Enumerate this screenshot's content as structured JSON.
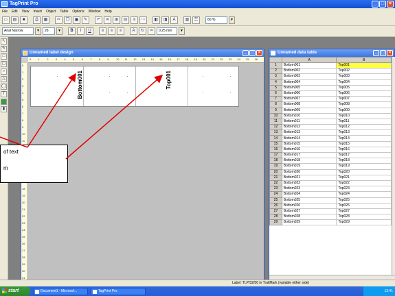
{
  "app": {
    "title": "TagPrint Pro"
  },
  "menu": [
    "File",
    "Edit",
    "View",
    "Insert",
    "Object",
    "Table",
    "Options",
    "Window",
    "Help"
  ],
  "toolbar": {
    "zoom": "60 %"
  },
  "format_bar": {
    "font": "Arial Narrow",
    "size": "26",
    "bold": "B",
    "italic": "I",
    "underline": "U",
    "dimension": "0.25 mm"
  },
  "label_window": {
    "title": "Unnamed label design",
    "ruler_ticks": [
      "0",
      "1",
      "2",
      "3",
      "4",
      "5",
      "6",
      "7",
      "8",
      "9",
      "10",
      "11",
      "12",
      "13",
      "14",
      "15",
      "16",
      "17",
      "18",
      "19",
      "20",
      "21",
      "22",
      "23",
      "24",
      "25",
      "26"
    ],
    "vertical_ticks": [
      "0",
      "1",
      "2",
      "3",
      "4",
      "5",
      "6",
      "7",
      "8",
      "9",
      "10",
      "11",
      "12",
      "13",
      "14",
      "15",
      "16",
      "17",
      "18",
      "19",
      "20",
      "21",
      "22",
      "23",
      "24",
      "25",
      "26",
      "27",
      "28",
      "29",
      "30",
      "31"
    ],
    "text_objects": [
      "Bottom001",
      "Top001"
    ]
  },
  "data_window": {
    "title": "Unnamed data table",
    "columns": [
      "A",
      "B"
    ],
    "rows": [
      [
        "1",
        "Bottom001",
        "Top001"
      ],
      [
        "2",
        "Bottom002",
        "Top002"
      ],
      [
        "3",
        "Bottom003",
        "Top003"
      ],
      [
        "4",
        "Bottom004",
        "Top004"
      ],
      [
        "5",
        "Bottom005",
        "Top005"
      ],
      [
        "6",
        "Bottom006",
        "Top006"
      ],
      [
        "7",
        "Bottom007",
        "Top007"
      ],
      [
        "8",
        "Bottom008",
        "Top008"
      ],
      [
        "9",
        "Bottom009",
        "Top009"
      ],
      [
        "10",
        "Bottom010",
        "Top010"
      ],
      [
        "11",
        "Bottom011",
        "Top011"
      ],
      [
        "12",
        "Bottom012",
        "Top012"
      ],
      [
        "13",
        "Bottom013",
        "Top013"
      ],
      [
        "14",
        "Bottom014",
        "Top014"
      ],
      [
        "15",
        "Bottom015",
        "Top015"
      ],
      [
        "16",
        "Bottom016",
        "Top016"
      ],
      [
        "17",
        "Bottom017",
        "Top017"
      ],
      [
        "18",
        "Bottom018",
        "Top018"
      ],
      [
        "19",
        "Bottom019",
        "Top019"
      ],
      [
        "20",
        "Bottom020",
        "Top020"
      ],
      [
        "21",
        "Bottom021",
        "Top021"
      ],
      [
        "22",
        "Bottom022",
        "Top022"
      ],
      [
        "23",
        "Bottom023",
        "Top023"
      ],
      [
        "24",
        "Bottom024",
        "Top024"
      ],
      [
        "25",
        "Bottom025",
        "Top025"
      ],
      [
        "26",
        "Bottom026",
        "Top026"
      ],
      [
        "27",
        "Bottom027",
        "Top027"
      ],
      [
        "28",
        "Bottom028",
        "Top028"
      ],
      [
        "29",
        "Bottom029",
        "Top029"
      ]
    ],
    "selected_cell": "B1"
  },
  "status": {
    "text": "Label: TLP/32/50 in TraitMark (variable either side)"
  },
  "taskbar": {
    "start": "start",
    "items": [
      "Document1 - Microsof...",
      "TagPrint Pro"
    ],
    "clock": "13:41"
  },
  "callout": {
    "line1": "of text",
    "line2": "m"
  },
  "colors": {
    "title_blue": "#1450d0",
    "arrow_red": "#e00000",
    "selection_yellow": "#ffff40"
  }
}
